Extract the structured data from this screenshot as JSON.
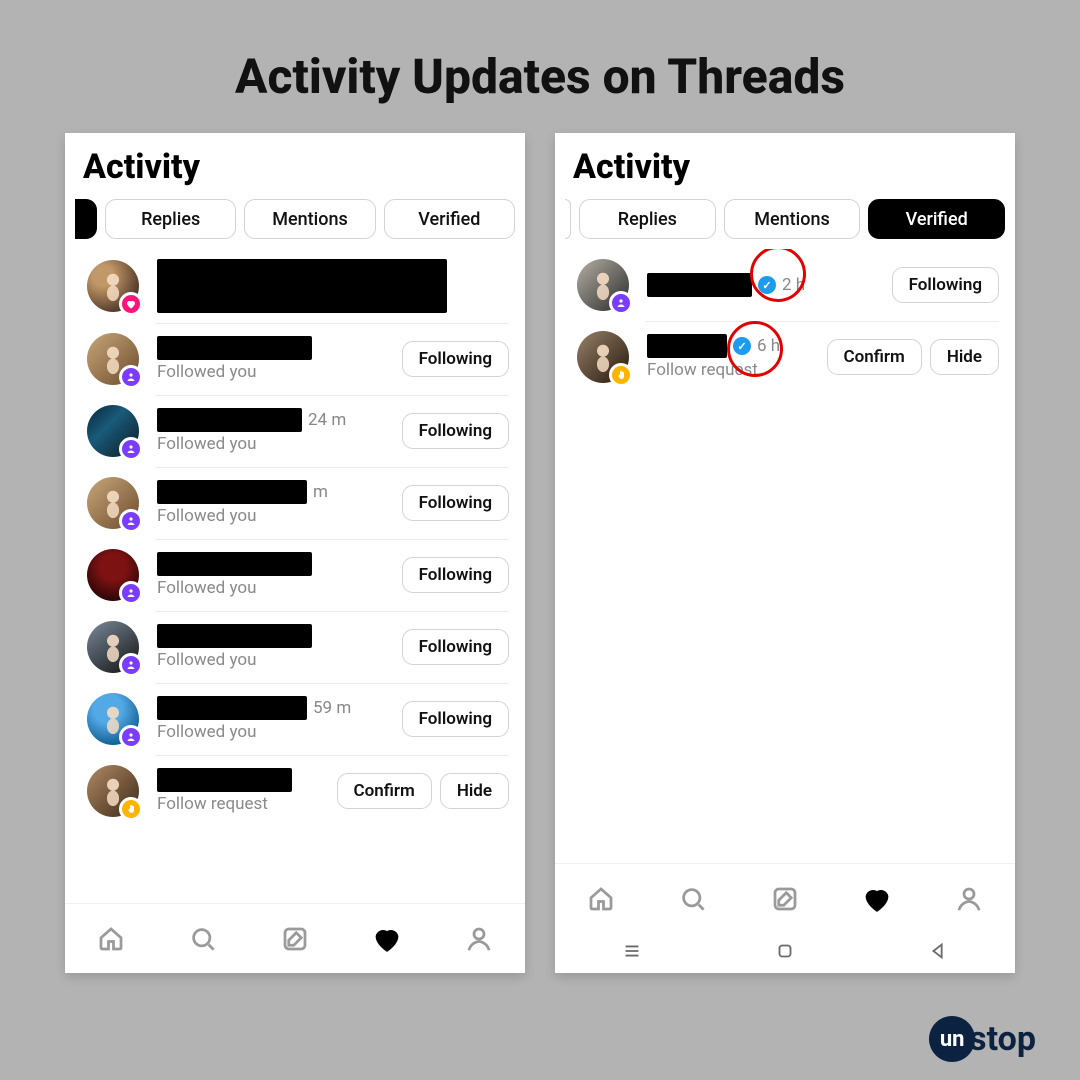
{
  "title": "Activity Updates on Threads",
  "brand": {
    "bubble": "un",
    "rest": "stop"
  },
  "filters": {
    "replies": "Replies",
    "mentions": "Mentions",
    "verified": "Verified"
  },
  "labels": {
    "header": "Activity",
    "followed_you": "Followed you",
    "follow_request": "Follow request",
    "following_btn": "Following",
    "confirm_btn": "Confirm",
    "hide_btn": "Hide"
  },
  "left": {
    "items": [
      {
        "kind": "big",
        "badge": "pink"
      },
      {
        "kind": "followed",
        "badge": "purple",
        "time": "",
        "name_w": 155
      },
      {
        "kind": "followed",
        "badge": "purple",
        "time": "24 m",
        "name_w": 145
      },
      {
        "kind": "followed",
        "badge": "purple",
        "time": "m",
        "name_w": 150
      },
      {
        "kind": "followed",
        "badge": "purple",
        "time": "",
        "name_w": 155
      },
      {
        "kind": "followed",
        "badge": "purple",
        "time": "",
        "name_w": 155
      },
      {
        "kind": "followed",
        "badge": "purple",
        "time": "59 m",
        "name_w": 150
      },
      {
        "kind": "request",
        "badge": "yellow"
      }
    ]
  },
  "right": {
    "items": [
      {
        "kind": "verified_following",
        "badge": "purple",
        "time": "2 h",
        "name_w": 105
      },
      {
        "kind": "verified_request",
        "badge": "yellow",
        "time": "6 h",
        "name_w": 80
      }
    ]
  }
}
